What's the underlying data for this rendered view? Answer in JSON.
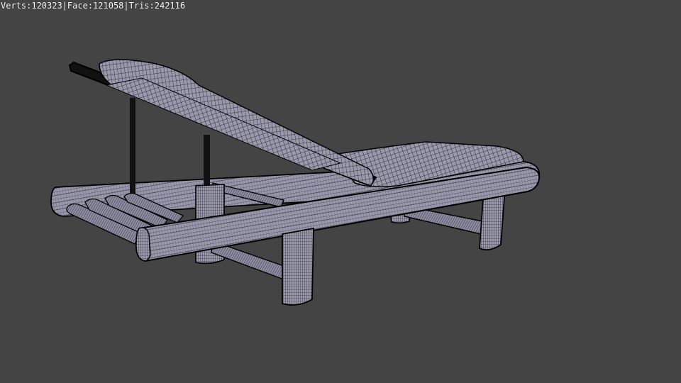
{
  "viewport": {
    "background_color": "#444444",
    "stats": "Verts:120323|Face:121058|Tris:242116"
  },
  "model": {
    "object": "sun lounger",
    "render_mode": "wireframe-on-shaded",
    "surface_color": "#9a98ad",
    "wire_color": "#111111"
  }
}
